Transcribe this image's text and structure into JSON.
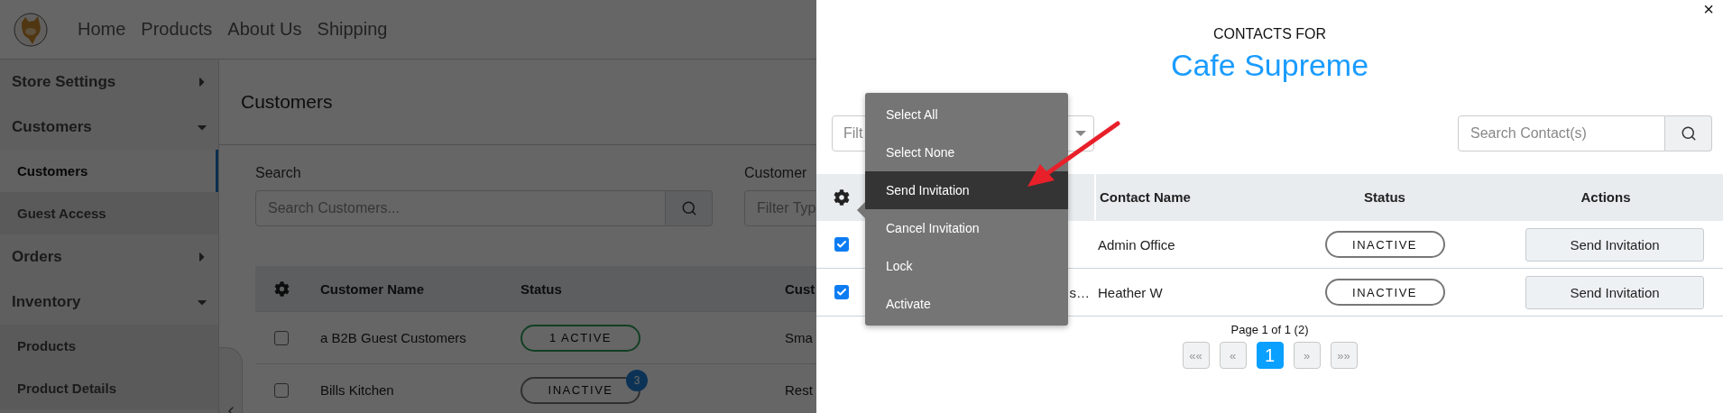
{
  "header": {
    "nav": [
      "Home",
      "Products",
      "About Us",
      "Shipping"
    ]
  },
  "sidebar": {
    "items": [
      {
        "label": "Store Settings",
        "expanded": false
      },
      {
        "label": "Customers",
        "expanded": true,
        "children": [
          {
            "label": "Customers",
            "selected": true
          },
          {
            "label": "Guest Access",
            "selected": false
          }
        ]
      },
      {
        "label": "Orders",
        "expanded": false
      },
      {
        "label": "Inventory",
        "expanded": true,
        "children": [
          {
            "label": "Products",
            "selected": false
          },
          {
            "label": "Product Details",
            "selected": false
          }
        ]
      }
    ]
  },
  "page": {
    "title": "Customers",
    "search": {
      "label": "Search",
      "placeholder": "Search Customers..."
    },
    "filter": {
      "label": "Customer",
      "placeholder": "Filter Typ"
    },
    "table": {
      "columns": [
        "Customer Name",
        "Status",
        "Cust"
      ],
      "rows": [
        {
          "checked": false,
          "name": "a B2B Guest Customers",
          "status": "1 ACTIVE",
          "active": true,
          "column_3": "Sma"
        },
        {
          "checked": false,
          "name": "Bills Kitchen",
          "status": "INACTIVE",
          "active": false,
          "badge": "3",
          "column_3": "Rest"
        }
      ]
    }
  },
  "contacts_panel": {
    "close": "×",
    "heading": "CONTACTS FOR",
    "customer": "Cafe Supreme",
    "filter": {
      "placeholder": "Filt"
    },
    "search": {
      "placeholder": "Search Contact(s)"
    },
    "table": {
      "columns": [
        "Contact Name",
        "Status",
        "Actions"
      ],
      "rows": [
        {
          "checked": true,
          "contact": "Admin Office",
          "status": "INACTIVE",
          "action": "Send Invitation"
        },
        {
          "checked": true,
          "column_2": "s…",
          "contact": "Heather W",
          "status": "INACTIVE",
          "action": "Send Invitation"
        }
      ]
    },
    "pagination": {
      "summary": "Page 1 of 1 (2)",
      "buttons": [
        {
          "label": "««",
          "selected": false
        },
        {
          "label": "«",
          "selected": false
        },
        {
          "label": "1",
          "selected": true
        },
        {
          "label": "»",
          "selected": false
        },
        {
          "label": "»»",
          "selected": false
        }
      ]
    },
    "menu": {
      "items": [
        {
          "label": "Select All",
          "selected": false
        },
        {
          "label": "Select None",
          "selected": false
        },
        {
          "label": "Send Invitation",
          "selected": true
        },
        {
          "label": "Cancel Invitation",
          "selected": false
        },
        {
          "label": "Lock",
          "selected": false
        },
        {
          "label": "Activate",
          "selected": false
        }
      ]
    }
  }
}
